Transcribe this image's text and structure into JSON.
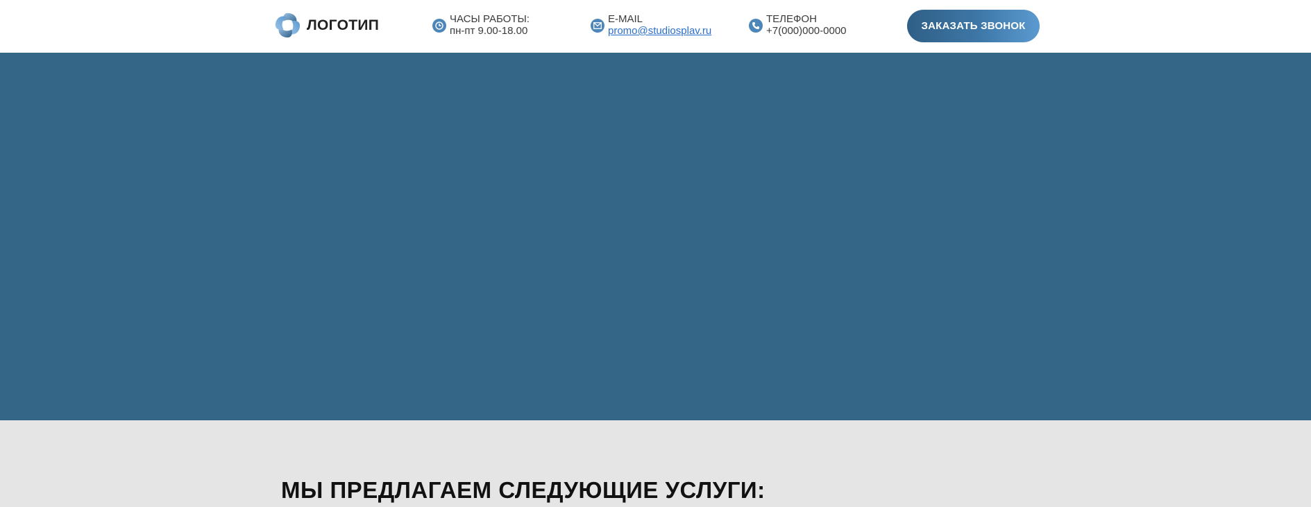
{
  "header": {
    "logo": {
      "text": "ЛОГОТИП",
      "icon": "logo-swirl-icon"
    },
    "hours": {
      "label": "ЧАСЫ РАБОТЫ:",
      "value": "пн-пт 9.00-18.00",
      "icon": "clock-icon"
    },
    "email": {
      "label": "E-MAIL",
      "value": "promo@studiosplav.ru",
      "icon": "envelope-icon"
    },
    "phone": {
      "label": "ТЕЛЕФОН",
      "value": "+7(000)000-0000",
      "icon": "phone-icon"
    },
    "cta_label": "ЗАКАЗАТЬ ЗВОНОК"
  },
  "services": {
    "heading": "МЫ ПРЕДЛАГАЕМ СЛЕДУЮЩИЕ УСЛУГИ:"
  },
  "colors": {
    "accent": "#4d86b8",
    "hero_bg": "#336687",
    "services_bg": "#e5e5e5",
    "link": "#2a6fc9"
  }
}
